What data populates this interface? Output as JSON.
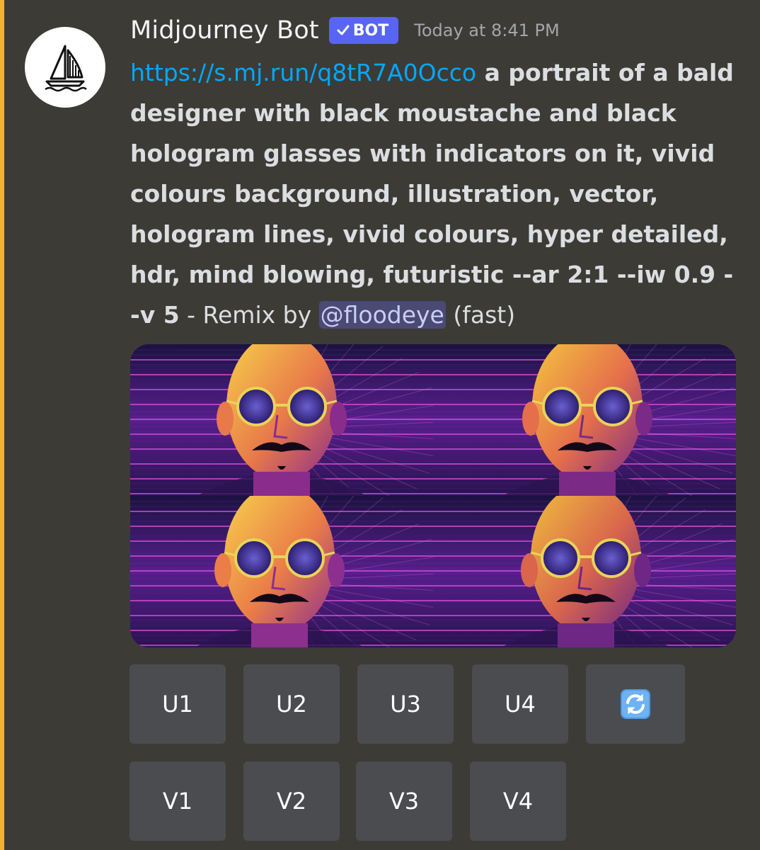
{
  "author": {
    "name": "Midjourney Bot",
    "tag": "BOT",
    "timestamp": "Today at 8:41 PM",
    "avatar_icon": "sailboat-icon"
  },
  "message": {
    "link": "https://s.mj.run/q8tR7A0Occo",
    "prompt": " a portrait of a bald designer with black moustache and black hologram glasses with indicators on it, vivid colours background, illustration, vector, hologram lines, vivid colours, hyper detailed, hdr, mind blowing, futuristic --ar 2:1 --iw 0.9 --v 5",
    "remix_prefix": " - Remix by ",
    "mention": "@floodeye",
    "suffix": " (fast)"
  },
  "image_grid": {
    "tiles": [
      "generated-image-1",
      "generated-image-2",
      "generated-image-3",
      "generated-image-4"
    ]
  },
  "buttons": {
    "upscale": [
      "U1",
      "U2",
      "U3",
      "U4"
    ],
    "reroll_icon": "refresh-icon",
    "variation": [
      "V1",
      "V2",
      "V3",
      "V4"
    ]
  },
  "colors": {
    "background": "#3d3b36",
    "mention_bar": "#f0b232",
    "bot_tag": "#5865f2",
    "link": "#00a8fc",
    "button": "#4a4c50"
  }
}
